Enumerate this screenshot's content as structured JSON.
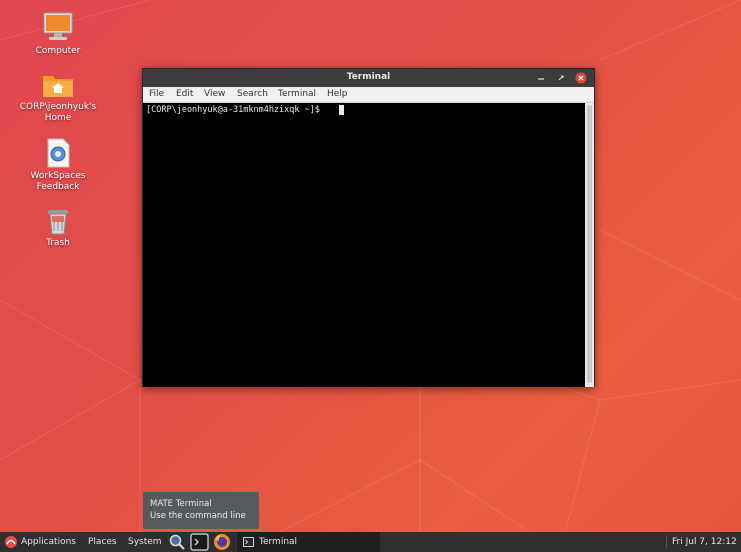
{
  "desktop": {
    "icons": [
      {
        "label": "Computer",
        "icon": "computer-icon"
      },
      {
        "label": "CORP\\jeonhyuk's Home",
        "icon": "home-folder-icon"
      },
      {
        "label": "WorkSpaces Feedback",
        "icon": "feedback-document-icon"
      },
      {
        "label": "Trash",
        "icon": "trash-icon"
      }
    ]
  },
  "window": {
    "title": "Terminal",
    "menu": [
      "File",
      "Edit",
      "View",
      "Search",
      "Terminal",
      "Help"
    ],
    "prompt": "[CORP\\jeonhyuk@a-31mknm4hzixqk ~]$"
  },
  "tooltip": {
    "title": "MATE Terminal",
    "description": "Use the command line"
  },
  "panel": {
    "menus": [
      "Applications",
      "Places",
      "System"
    ],
    "task_label": "Terminal",
    "clock": "Fri Jul  7, 12:12"
  },
  "colors": {
    "accent": "#e5504a",
    "close_button": "#e0453a",
    "panel": "#2f2f2f"
  }
}
